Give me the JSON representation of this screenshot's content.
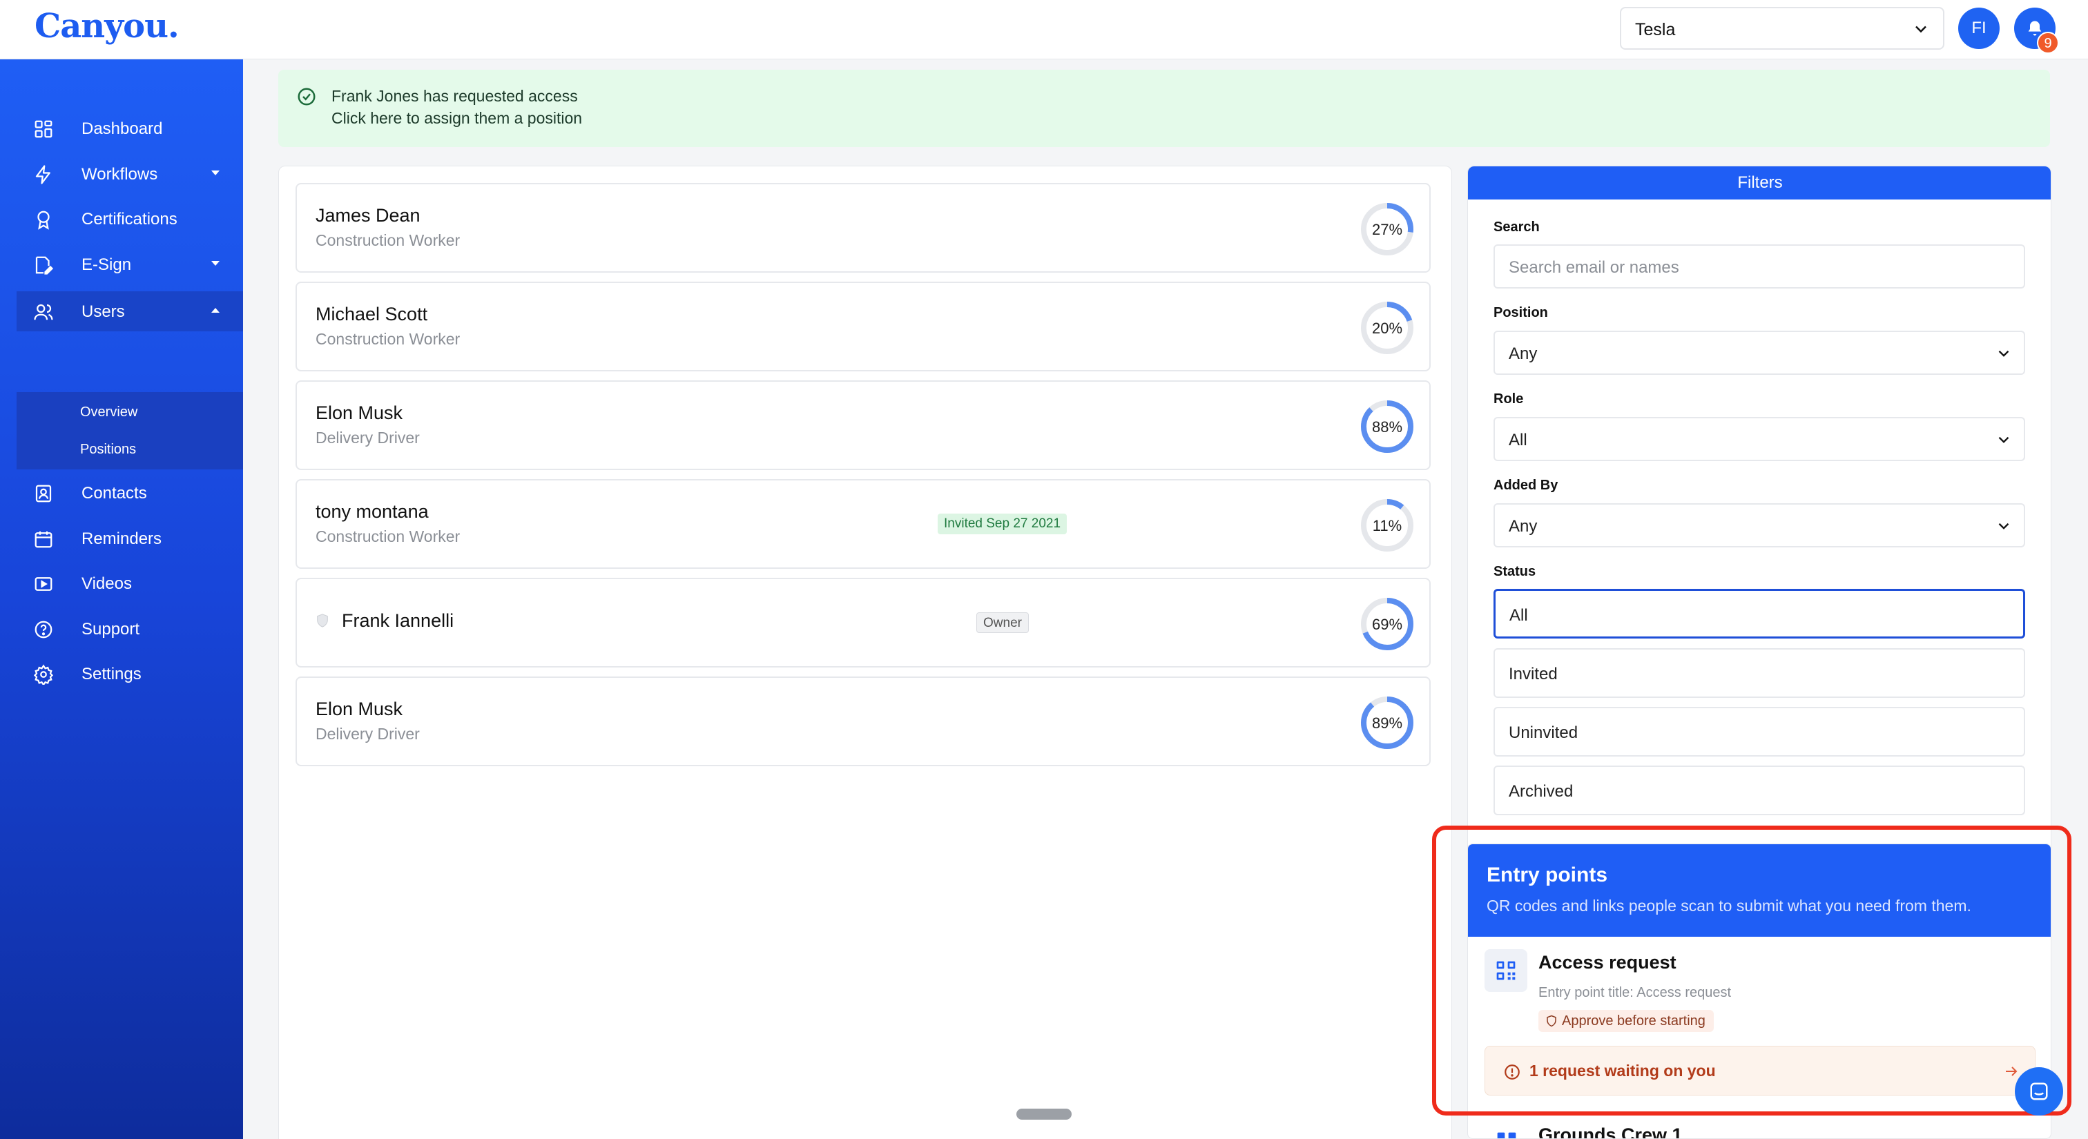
{
  "app": {
    "logo": "Canyou.",
    "org_selected": "Tesla",
    "avatar_initials": "FI",
    "notification_count": "9"
  },
  "sidebar": {
    "items": [
      {
        "label": "Dashboard",
        "icon": "grid-icon"
      },
      {
        "label": "Workflows",
        "icon": "lightning-icon"
      },
      {
        "label": "Certifications",
        "icon": "award-icon"
      },
      {
        "label": "E-Sign",
        "icon": "sign-icon"
      },
      {
        "label": "Users",
        "icon": "users-icon"
      },
      {
        "label": "Contacts",
        "icon": "contact-icon"
      },
      {
        "label": "Reminders",
        "icon": "calendar-icon"
      },
      {
        "label": "Videos",
        "icon": "video-icon"
      },
      {
        "label": "Support",
        "icon": "help-icon"
      },
      {
        "label": "Settings",
        "icon": "gear-icon"
      }
    ],
    "users_sub": [
      "Overview",
      "Positions"
    ]
  },
  "banner": {
    "title": "Frank Jones has requested access",
    "subtitle": "Click here to assign them a position"
  },
  "users": [
    {
      "name": "James Dean",
      "position": "Construction Worker",
      "progress": 27,
      "progress_label": "27%"
    },
    {
      "name": "Michael Scott",
      "position": "Construction Worker",
      "progress": 20,
      "progress_label": "20%"
    },
    {
      "name": "Elon Musk",
      "position": "Delivery Driver",
      "progress": 88,
      "progress_label": "88%"
    },
    {
      "name": "tony montana",
      "position": "Construction Worker",
      "tag": "Invited Sep 27 2021",
      "progress": 11,
      "progress_label": "11%"
    },
    {
      "name": "Frank Iannelli",
      "position": "",
      "tag": "Owner",
      "progress": 69,
      "progress_label": "69%"
    },
    {
      "name": "Elon Musk",
      "position": "Delivery Driver",
      "progress": 89,
      "progress_label": "89%"
    }
  ],
  "filters": {
    "title": "Filters",
    "search_label": "Search",
    "search_placeholder": "Search email or names",
    "position_label": "Position",
    "position_value": "Any",
    "role_label": "Role",
    "role_value": "All",
    "added_by_label": "Added By",
    "added_by_value": "Any",
    "status_label": "Status",
    "status_options": [
      "All",
      "Invited",
      "Uninvited",
      "Archived"
    ]
  },
  "entry_points": {
    "title": "Entry points",
    "description": "QR codes and links people scan to submit what you need from them.",
    "item_title": "Access request",
    "item_subtitle": "Entry point title: Access request",
    "item_chip": "Approve before starting",
    "waiting_text": "1 request waiting on you",
    "next_item_title": "Grounds Crew 1"
  },
  "colors": {
    "primary": "#1f5ef5",
    "highlight_outline": "#ef2b1b",
    "ring_fill": "#5b8ef0",
    "ring_track": "#e5e7eb"
  }
}
